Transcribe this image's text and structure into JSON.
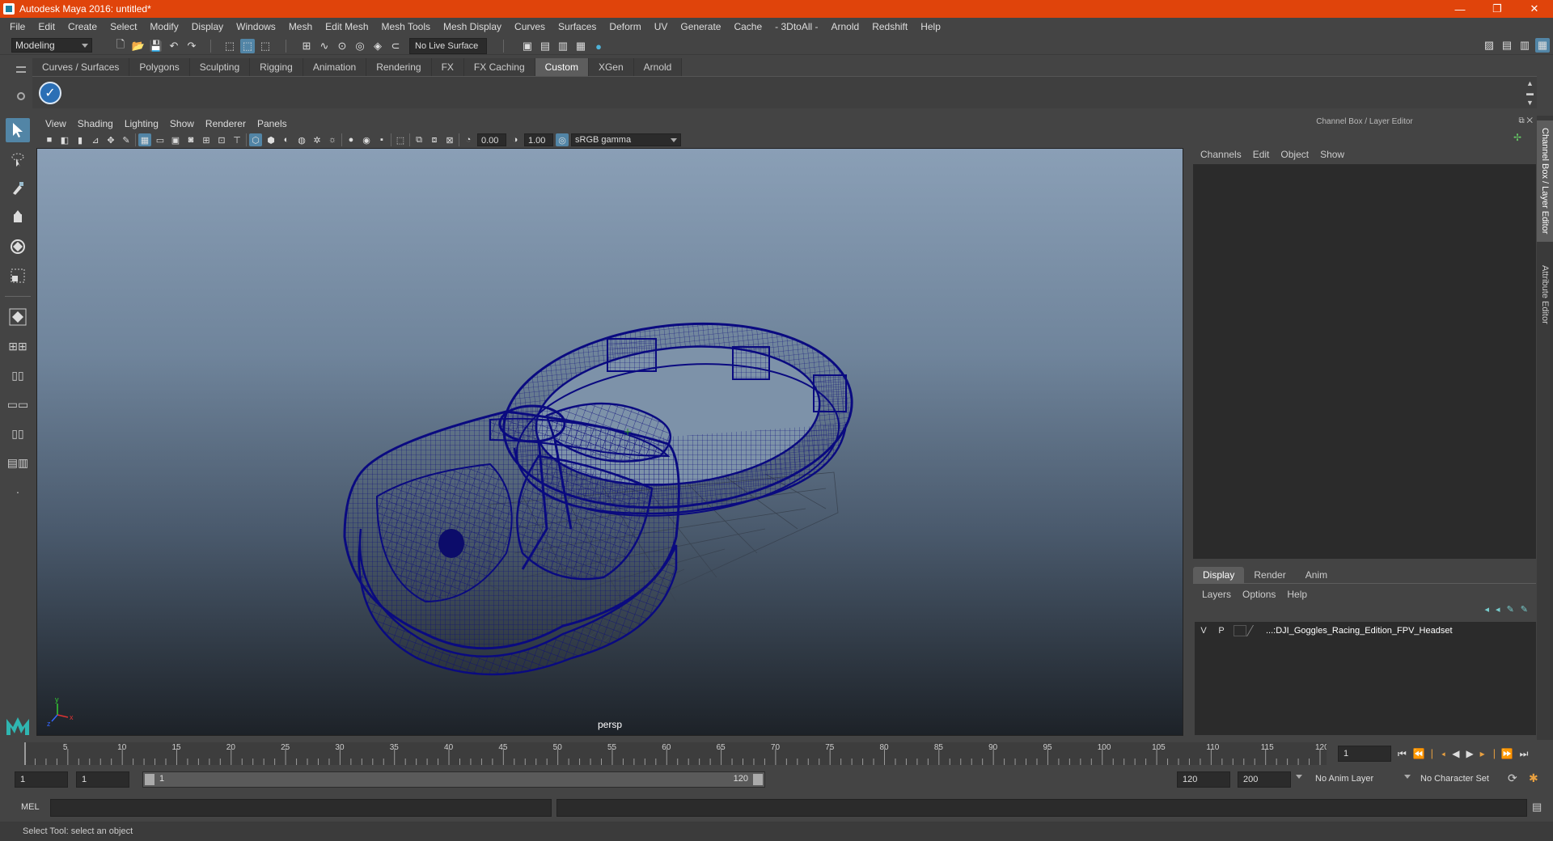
{
  "window": {
    "title": "Autodesk Maya 2016: untitled*",
    "controls": {
      "minimize": "—",
      "restore": "❐",
      "close": "✕"
    }
  },
  "menubar": [
    "File",
    "Edit",
    "Create",
    "Select",
    "Modify",
    "Display",
    "Windows",
    "Mesh",
    "Edit Mesh",
    "Mesh Tools",
    "Mesh Display",
    "Curves",
    "Surfaces",
    "Deform",
    "UV",
    "Generate",
    "Cache",
    "- 3DtoAll -",
    "Arnold",
    "Redshift",
    "Help"
  ],
  "statusline": {
    "mode": "Modeling",
    "live_surface": "No Live Surface"
  },
  "shelf": {
    "tabs": [
      "Curves / Surfaces",
      "Polygons",
      "Sculpting",
      "Rigging",
      "Animation",
      "Rendering",
      "FX",
      "FX Caching",
      "Custom",
      "XGen",
      "Arnold"
    ],
    "active_tab": "Custom"
  },
  "viewport": {
    "menu": [
      "View",
      "Shading",
      "Lighting",
      "Show",
      "Renderer",
      "Panels"
    ],
    "exposure": "0.00",
    "gamma": "1.00",
    "color_space": "sRGB gamma",
    "camera_label": "persp"
  },
  "channel_box": {
    "title": "Channel Box / Layer Editor",
    "menu": [
      "Channels",
      "Edit",
      "Object",
      "Show"
    ]
  },
  "layer_editor": {
    "tabs": [
      "Display",
      "Render",
      "Anim"
    ],
    "active_tab": "Display",
    "menu": [
      "Layers",
      "Options",
      "Help"
    ],
    "layers": [
      {
        "visible": "V",
        "playback": "P",
        "name": "...:DJI_Goggles_Racing_Edition_FPV_Headset"
      }
    ]
  },
  "side_tabs": [
    "Channel Box / Layer Editor",
    "Attribute Editor"
  ],
  "timeline": {
    "ticks": [
      "1",
      "5",
      "10",
      "15",
      "20",
      "25",
      "30",
      "35",
      "40",
      "45",
      "50",
      "55",
      "60",
      "65",
      "70",
      "75",
      "80",
      "85",
      "90",
      "95",
      "100",
      "105",
      "110",
      "115",
      "120"
    ],
    "current_frame": "1",
    "tick_range": [
      1,
      120
    ]
  },
  "range": {
    "start": "1",
    "playback_start": "1",
    "slider_start": "1",
    "slider_end": "120",
    "playback_end": "120",
    "end": "200",
    "anim_layer": "No Anim Layer",
    "character_set": "No Character Set"
  },
  "mel": {
    "label": "MEL"
  },
  "helpline": "Select Tool: select an object"
}
